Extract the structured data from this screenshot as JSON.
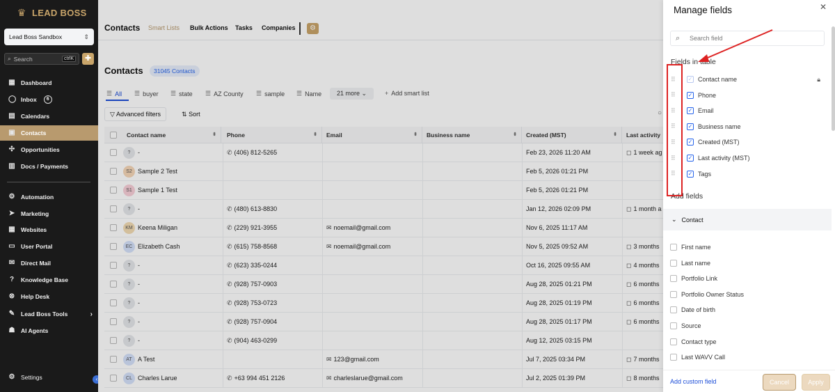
{
  "sidebar": {
    "logo_text": "LEAD BOSS",
    "account_name": "Lead Boss Sandbox",
    "search_placeholder": "Search",
    "search_shortcut": "ctrlK",
    "items": [
      {
        "label": "Dashboard",
        "icon": "grid-icon"
      },
      {
        "label": "Inbox",
        "icon": "chat-icon",
        "badge": "6"
      },
      {
        "label": "Calendars",
        "icon": "calendar-icon"
      },
      {
        "label": "Contacts",
        "icon": "contacts-icon",
        "active": true
      },
      {
        "label": "Opportunities",
        "icon": "opportunities-icon"
      },
      {
        "label": "Docs / Payments",
        "icon": "doc-icon"
      },
      {
        "label": "Automation",
        "icon": "automation-icon"
      },
      {
        "label": "Marketing",
        "icon": "send-icon"
      },
      {
        "label": "Websites",
        "icon": "globe-icon"
      },
      {
        "label": "User Portal",
        "icon": "monitor-icon"
      },
      {
        "label": "Direct Mail",
        "icon": "mail-icon"
      },
      {
        "label": "Knowledge Base",
        "icon": "help-circle-icon"
      },
      {
        "label": "Help Desk",
        "icon": "lifebuoy-icon"
      },
      {
        "label": "Lead Boss Tools",
        "icon": "wrench-icon"
      },
      {
        "label": "AI Agents",
        "icon": "robot-icon"
      }
    ],
    "settings_label": "Settings"
  },
  "topnav": {
    "title": "Contacts",
    "tabs": [
      "Smart Lists",
      "Bulk Actions",
      "Tasks",
      "Companies"
    ]
  },
  "page": {
    "title": "Contacts",
    "count": "31045 Contacts",
    "list_tabs": [
      "All",
      "buyer",
      "state",
      "AZ County",
      "sample",
      "Name"
    ],
    "more": "21 more",
    "add_smart_list": "Add smart list",
    "advanced_filters": "Advanced filters",
    "sort": "Sort"
  },
  "table": {
    "columns": [
      "Contact name",
      "Phone",
      "Email",
      "Business name",
      "Created (MST)",
      "Last activity"
    ],
    "rows": [
      {
        "initials": "?",
        "name": "-",
        "avatar_color": "#e5e7eb",
        "phone": "(406) 812-5265",
        "email": "",
        "created": "Feb 23, 2026 11:20 AM",
        "activity": "1 week ag"
      },
      {
        "initials": "S2",
        "name": "Sample 2 Test",
        "avatar_color": "#f6d7b8",
        "phone": "",
        "email": "",
        "created": "Feb 5, 2026 01:21 PM",
        "activity": ""
      },
      {
        "initials": "S1",
        "name": "Sample 1 Test",
        "avatar_color": "#f8cfd8",
        "phone": "",
        "email": "",
        "created": "Feb 5, 2026 01:21 PM",
        "activity": ""
      },
      {
        "initials": "?",
        "name": "-",
        "avatar_color": "#e5e7eb",
        "phone": "(480) 613-8830",
        "email": "",
        "created": "Jan 12, 2026 02:09 PM",
        "activity": "1 month a"
      },
      {
        "initials": "KM",
        "name": "Keena Miligan",
        "avatar_color": "#f3dcb4",
        "phone": "(229) 921-3955",
        "email": "noemail@gmail.com",
        "created": "Nov 6, 2025 11:17 AM",
        "activity": ""
      },
      {
        "initials": "EC",
        "name": "Elizabeth Cash",
        "avatar_color": "#d5e2fb",
        "phone": "(615) 758-8568",
        "email": "noemail@gmail.com",
        "created": "Nov 5, 2025 09:52 AM",
        "activity": "3 months"
      },
      {
        "initials": "?",
        "name": "-",
        "avatar_color": "#e5e7eb",
        "phone": "(623) 335-0244",
        "email": "",
        "created": "Oct 16, 2025 09:55 AM",
        "activity": "4 months"
      },
      {
        "initials": "?",
        "name": "-",
        "avatar_color": "#e5e7eb",
        "phone": "(928) 757-0903",
        "email": "",
        "created": "Aug 28, 2025 01:21 PM",
        "activity": "6 months"
      },
      {
        "initials": "?",
        "name": "-",
        "avatar_color": "#e5e7eb",
        "phone": "(928) 753-0723",
        "email": "",
        "created": "Aug 28, 2025 01:19 PM",
        "activity": "6 months"
      },
      {
        "initials": "?",
        "name": "-",
        "avatar_color": "#e5e7eb",
        "phone": "(928) 757-0904",
        "email": "",
        "created": "Aug 28, 2025 01:17 PM",
        "activity": "6 months"
      },
      {
        "initials": "?",
        "name": "-",
        "avatar_color": "#e5e7eb",
        "phone": "(904) 463-0299",
        "email": "",
        "created": "Aug 12, 2025 03:15 PM",
        "activity": ""
      },
      {
        "initials": "AT",
        "name": "A Test",
        "avatar_color": "#d5e2fb",
        "phone": "",
        "email": "123@gmail.com",
        "created": "Jul 7, 2025 03:34 PM",
        "activity": "7 months"
      },
      {
        "initials": "CL",
        "name": "Charles Larue",
        "avatar_color": "#d5e2fb",
        "phone": "+63 994 451 2126",
        "email": "charleslarue@gmail.com",
        "created": "Jul 2, 2025 01:39 PM",
        "activity": "8 months"
      }
    ]
  },
  "drawer": {
    "title": "Manage fields",
    "search_placeholder": "Search field",
    "fields_in_table_label": "Fields in table",
    "fields_in_table": [
      "Contact name",
      "Phone",
      "Email",
      "Business name",
      "Created (MST)",
      "Last activity (MST)",
      "Tags"
    ],
    "add_fields_label": "Add fields",
    "section": "Contact",
    "add_fields": [
      "First name",
      "Last name",
      "Portfolio Link",
      "Portfolio Owner Status",
      "Date of birth",
      "Source",
      "Contact type",
      "Last WAVV Call"
    ],
    "add_custom_field": "Add custom field",
    "cancel": "Cancel",
    "apply": "Apply"
  },
  "colors": {
    "sidebar_bg": "#1a1a1a",
    "brand_gold": "#c9a56a",
    "active_nav": "#b89a6e",
    "link_blue": "#1d4ed8",
    "annotation_red": "#dd2222"
  }
}
